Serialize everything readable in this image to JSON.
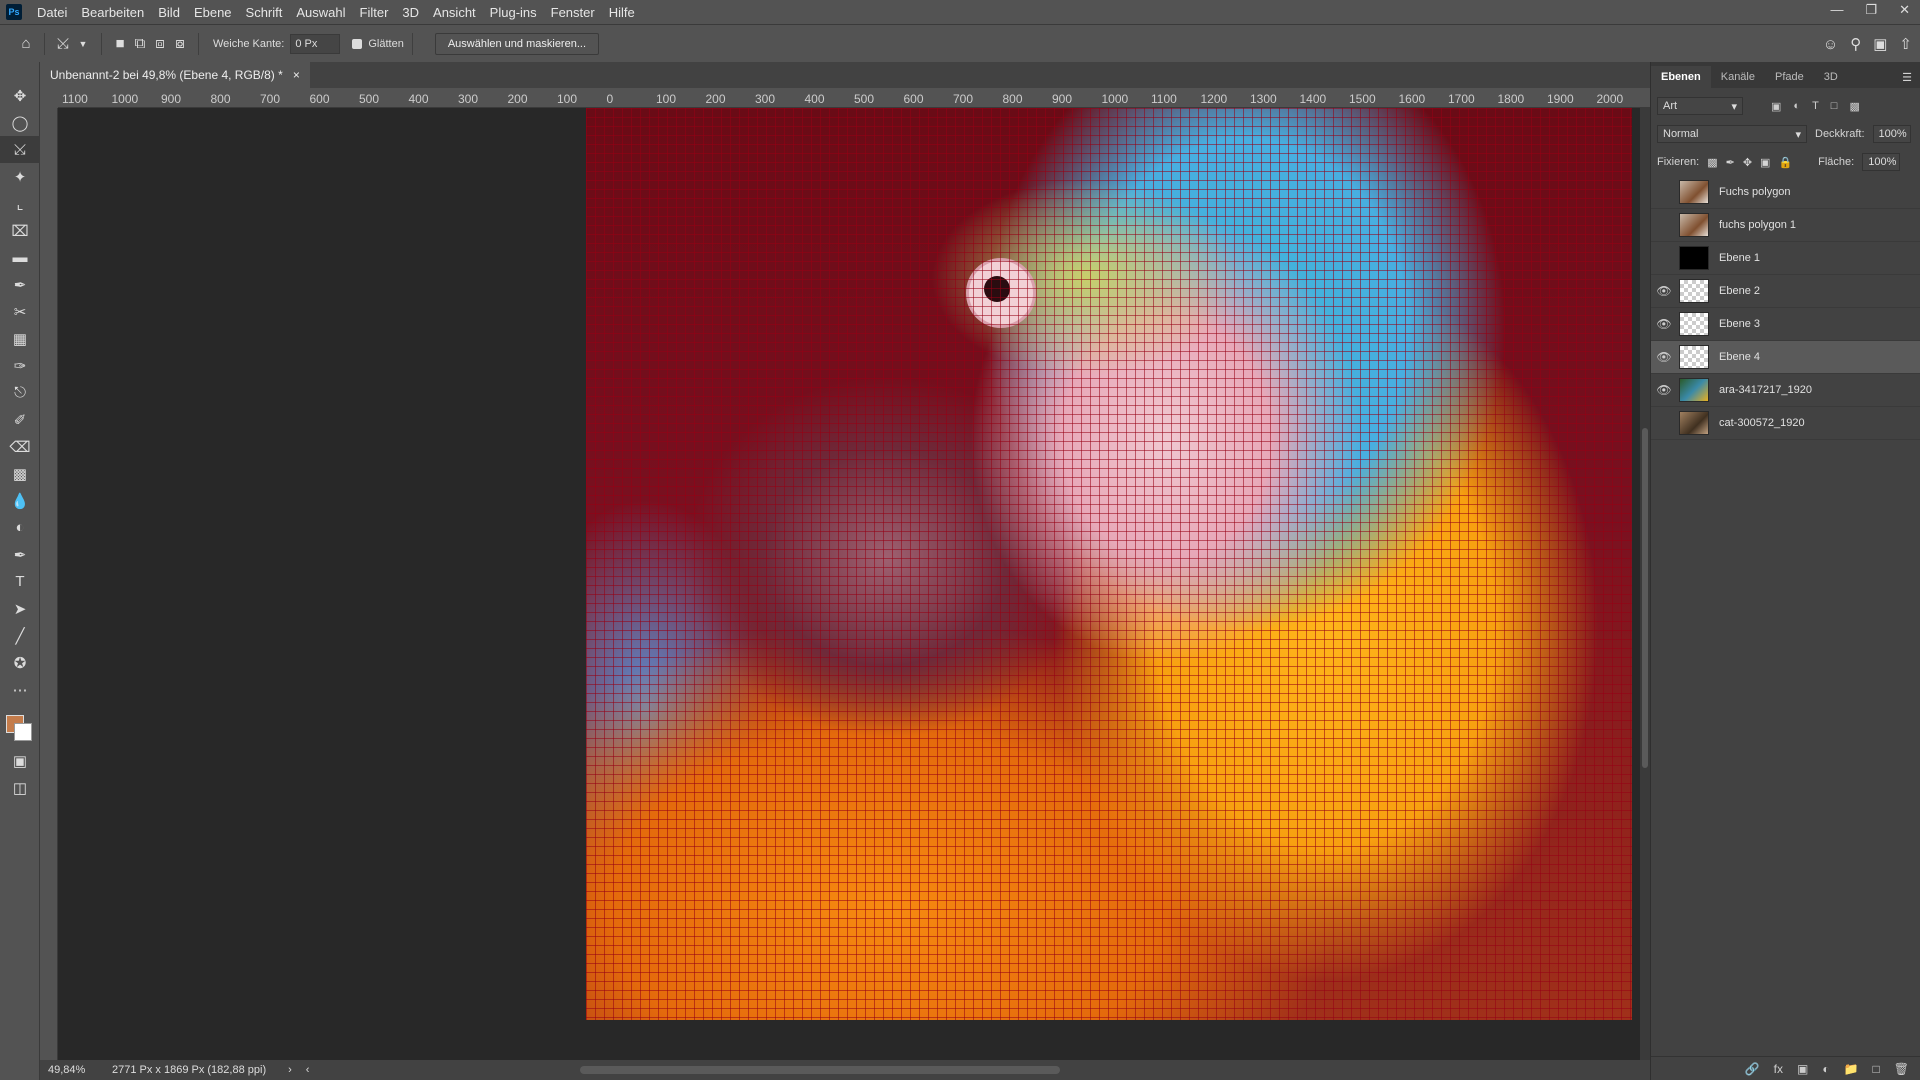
{
  "menubar": {
    "logo": "Ps",
    "items": [
      "Datei",
      "Bearbeiten",
      "Bild",
      "Ebene",
      "Schrift",
      "Auswahl",
      "Filter",
      "3D",
      "Ansicht",
      "Plug-ins",
      "Fenster",
      "Hilfe"
    ]
  },
  "options": {
    "feather_label": "Weiche Kante:",
    "feather_value": "0 Px",
    "smooth_label": "Glätten",
    "select_mask_button": "Auswählen und maskieren..."
  },
  "document": {
    "tab_title": "Unbenannt-2 bei 49,8% (Ebene 4, RGB/8) *"
  },
  "ruler": {
    "ticks": [
      "1100",
      "1000",
      "900",
      "800",
      "700",
      "600",
      "500",
      "400",
      "300",
      "200",
      "100",
      "0",
      "100",
      "200",
      "300",
      "400",
      "500",
      "600",
      "700",
      "800",
      "900",
      "1000",
      "1100",
      "1200",
      "1300",
      "1400",
      "1500",
      "1600",
      "1700",
      "1800",
      "1900",
      "2000"
    ]
  },
  "status": {
    "zoom": "49,84%",
    "dimensions": "2771 Px x 1869 Px (182,88 ppi)"
  },
  "panel": {
    "tabs": [
      "Ebenen",
      "Kanäle",
      "Pfade",
      "3D"
    ],
    "filter_kind": "Art",
    "blend_mode": "Normal",
    "opacity_label": "Deckkraft:",
    "opacity_value": "100%",
    "lock_label": "Fixieren:",
    "fill_label": "Fläche:",
    "fill_value": "100%"
  },
  "layers": [
    {
      "name": "Fuchs polygon",
      "visible": false,
      "thumb": "fox"
    },
    {
      "name": "fuchs polygon 1",
      "visible": false,
      "thumb": "fox"
    },
    {
      "name": "Ebene 1",
      "visible": false,
      "thumb": "black"
    },
    {
      "name": "Ebene 2",
      "visible": true,
      "thumb": "checker"
    },
    {
      "name": "Ebene 3",
      "visible": true,
      "thumb": "checker"
    },
    {
      "name": "Ebene 4",
      "visible": true,
      "thumb": "checker",
      "selected": true
    },
    {
      "name": "ara-3417217_1920",
      "visible": true,
      "thumb": "parrot"
    },
    {
      "name": "cat-300572_1920",
      "visible": false,
      "thumb": "cat"
    }
  ],
  "colors": {
    "foreground": "#c47c4b",
    "background": "#ffffff"
  }
}
